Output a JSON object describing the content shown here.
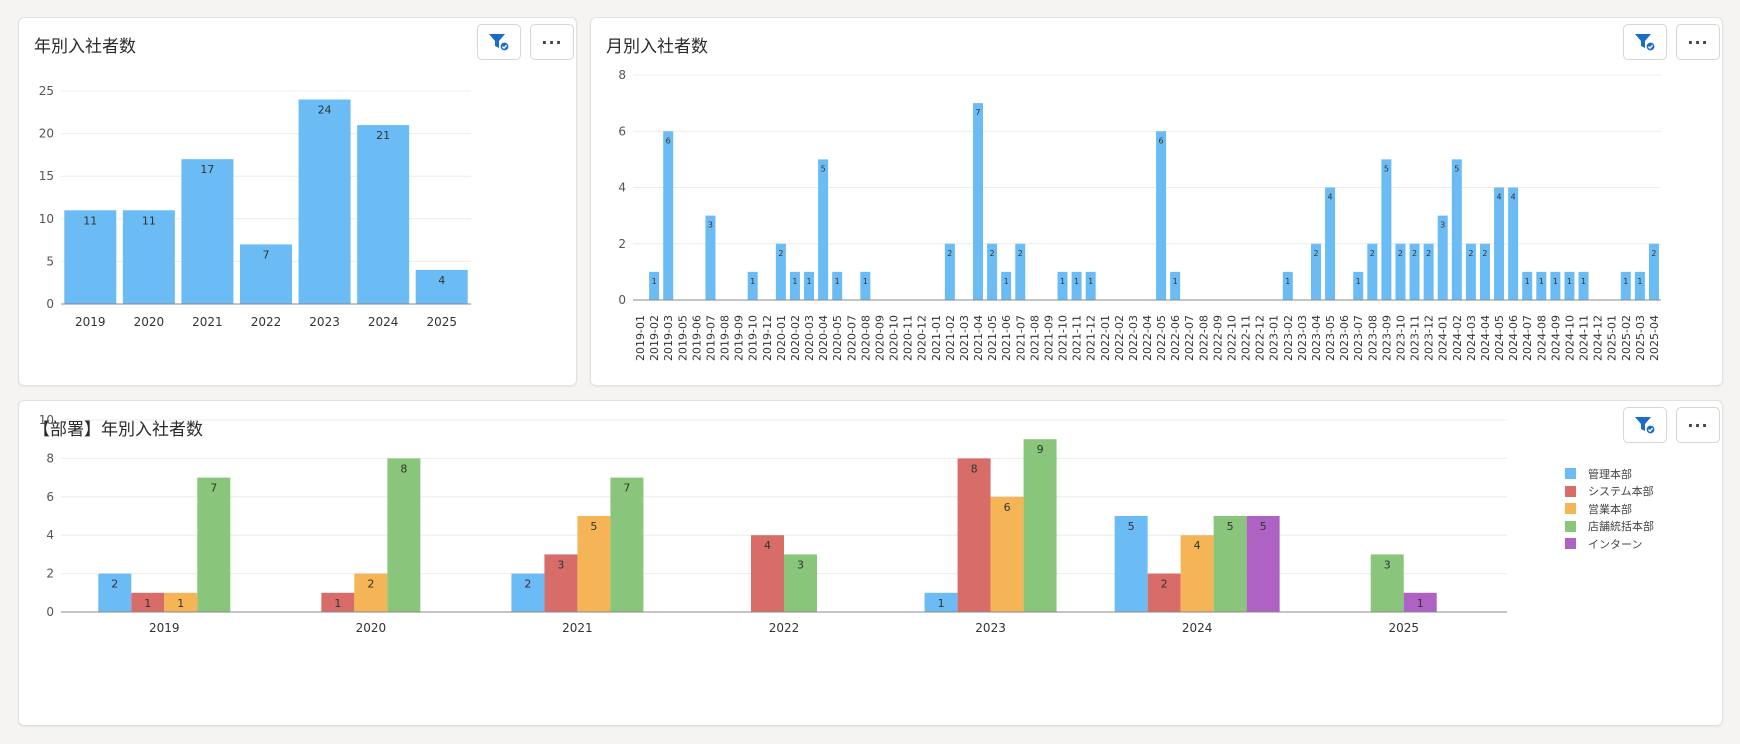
{
  "colors": {
    "bar": "#6bbcf5"
  },
  "cards": {
    "yearly": {
      "title": "年別入社者数"
    },
    "monthly": {
      "title": "月別入社者数"
    },
    "dept": {
      "title": "【部署】年別入社者数"
    }
  },
  "icons": {
    "filter": "filter-check-icon",
    "more": "more-horizontal-icon"
  },
  "chart_data": [
    {
      "type": "bar",
      "title": "年別入社者数",
      "categories": [
        "2019",
        "2020",
        "2021",
        "2022",
        "2023",
        "2024",
        "2025"
      ],
      "values": [
        11,
        11,
        17,
        7,
        24,
        21,
        4
      ],
      "ylim": [
        0,
        25
      ],
      "yticks": [
        0,
        5,
        10,
        15,
        20,
        25
      ]
    },
    {
      "type": "bar",
      "title": "月別入社者数",
      "categories": [
        "2019-01",
        "2019-02",
        "2019-03",
        "2019-05",
        "2019-06",
        "2019-07",
        "2019-08",
        "2019-09",
        "2019-10",
        "2019-12",
        "2020-01",
        "2020-02",
        "2020-03",
        "2020-04",
        "2020-05",
        "2020-07",
        "2020-08",
        "2020-09",
        "2020-10",
        "2020-11",
        "2020-12",
        "2021-01",
        "2021-02",
        "2021-03",
        "2021-04",
        "2021-05",
        "2021-06",
        "2021-07",
        "2021-08",
        "2021-09",
        "2021-10",
        "2021-11",
        "2021-12",
        "2022-01",
        "2022-02",
        "2022-03",
        "2022-04",
        "2022-05",
        "2022-06",
        "2022-07",
        "2022-08",
        "2022-09",
        "2022-10",
        "2022-11",
        "2022-12",
        "2023-01",
        "2023-02",
        "2023-03",
        "2023-04",
        "2023-05",
        "2023-06",
        "2023-07",
        "2023-08",
        "2023-09",
        "2023-10",
        "2023-11",
        "2023-12",
        "2024-01",
        "2024-02",
        "2024-03",
        "2024-04",
        "2024-05",
        "2024-06",
        "2024-07",
        "2024-08",
        "2024-09",
        "2024-10",
        "2024-11",
        "2024-12",
        "2025-01",
        "2025-02",
        "2025-03",
        "2025-04"
      ],
      "values": [
        0,
        1,
        6,
        0,
        0,
        3,
        0,
        0,
        1,
        0,
        2,
        1,
        1,
        5,
        1,
        0,
        1,
        0,
        0,
        0,
        0,
        0,
        2,
        0,
        7,
        2,
        1,
        2,
        0,
        0,
        1,
        1,
        1,
        0,
        0,
        0,
        0,
        6,
        1,
        0,
        0,
        0,
        0,
        0,
        0,
        0,
        1,
        0,
        2,
        4,
        0,
        1,
        2,
        5,
        2,
        2,
        2,
        3,
        5,
        2,
        2,
        4,
        4,
        1,
        1,
        1,
        1,
        1,
        0,
        0,
        1,
        1,
        2
      ],
      "ylim": [
        0,
        8
      ],
      "yticks": [
        0,
        2,
        4,
        6,
        8
      ]
    },
    {
      "type": "bar",
      "title": "【部署】年別入社者数",
      "categories": [
        "2019",
        "2020",
        "2021",
        "2022",
        "2023",
        "2024",
        "2025"
      ],
      "ylim": [
        0,
        10
      ],
      "yticks": [
        0,
        2,
        4,
        6,
        8,
        10
      ],
      "series": [
        {
          "name": "管理本部",
          "color": "#6bbcf5",
          "values": [
            2,
            null,
            2,
            null,
            1,
            5,
            null
          ]
        },
        {
          "name": "システム本部",
          "color": "#d86c68",
          "values": [
            1,
            1,
            3,
            4,
            8,
            2,
            null
          ]
        },
        {
          "name": "営業本部",
          "color": "#f5b556",
          "values": [
            1,
            2,
            5,
            null,
            6,
            4,
            null
          ]
        },
        {
          "name": "店舗統括本部",
          "color": "#89c67b",
          "values": [
            7,
            8,
            7,
            3,
            9,
            5,
            3
          ]
        },
        {
          "name": "インターン",
          "color": "#ad62c4",
          "values": [
            null,
            null,
            null,
            null,
            null,
            5,
            1
          ]
        }
      ]
    }
  ]
}
